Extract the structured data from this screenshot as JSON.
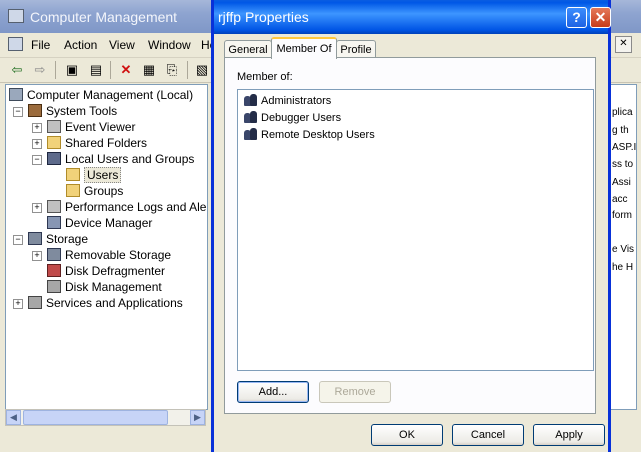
{
  "background_window": {
    "title": "Computer Management",
    "menu": [
      "File",
      "Action",
      "View",
      "Window",
      "He"
    ],
    "tree": [
      {
        "label": "Computer Management (Local)",
        "icon": "computer-icon",
        "toggle": ""
      },
      {
        "label": "System Tools",
        "icon": "tools-icon",
        "toggle": "−"
      },
      {
        "label": "Event Viewer",
        "icon": "event-viewer-icon",
        "toggle": "+"
      },
      {
        "label": "Shared Folders",
        "icon": "shared-folders-icon",
        "toggle": "+"
      },
      {
        "label": "Local Users and Groups",
        "icon": "users-groups-icon",
        "toggle": "−"
      },
      {
        "label": "Users",
        "icon": "folder-open-icon",
        "toggle": ""
      },
      {
        "label": "Groups",
        "icon": "folder-icon",
        "toggle": ""
      },
      {
        "label": "Performance Logs and Alerts",
        "icon": "performance-icon",
        "toggle": "+"
      },
      {
        "label": "Device Manager",
        "icon": "device-manager-icon",
        "toggle": ""
      },
      {
        "label": "Storage",
        "icon": "storage-icon",
        "toggle": "−"
      },
      {
        "label": "Removable Storage",
        "icon": "removable-storage-icon",
        "toggle": "+"
      },
      {
        "label": "Disk Defragmenter",
        "icon": "defrag-icon",
        "toggle": ""
      },
      {
        "label": "Disk Management",
        "icon": "disk-management-icon",
        "toggle": ""
      },
      {
        "label": "Services and Applications",
        "icon": "services-icon",
        "toggle": "+"
      }
    ],
    "right_pane_fragments": [
      "plica",
      "g th",
      "ASP.I",
      "ss to",
      "Assi",
      "acc",
      "form",
      "e Vis",
      "he H"
    ]
  },
  "dialog": {
    "title": "rjffp Properties",
    "help_glyph": "?",
    "close_glyph": "✕",
    "tabs": [
      "General",
      "Member Of",
      "Profile"
    ],
    "active_tab": "Member Of",
    "member_of_label": "Member of:",
    "members": [
      "Administrators",
      "Debugger Users",
      "Remote Desktop Users"
    ],
    "add_label": "Add...",
    "remove_label": "Remove",
    "ok_label": "OK",
    "cancel_label": "Cancel",
    "apply_label": "Apply"
  },
  "colors": {
    "dialog_border": "#0831d9",
    "active_tab_accent": "#ffc83c",
    "inactive_title": "#8ea4d0"
  }
}
